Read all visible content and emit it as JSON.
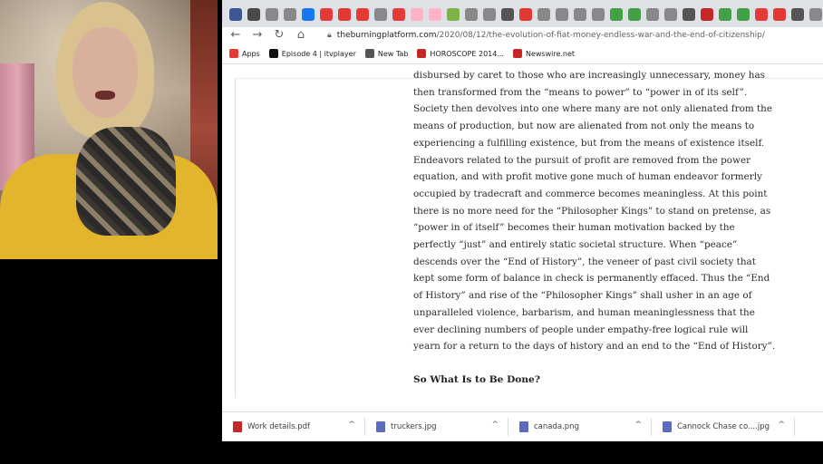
{
  "browser": {
    "tab_icon_colors": [
      "#3b5998",
      "#4a4a4a",
      "#888",
      "#888",
      "#1877f2",
      "#e53935",
      "#e53935",
      "#e53935",
      "#888",
      "#e53935",
      "#ffb3c7",
      "#ffb3c7",
      "#7cb342",
      "#888",
      "#888",
      "#555",
      "#e53935",
      "#888",
      "#888",
      "#888",
      "#888",
      "#43a047",
      "#43a047",
      "#888",
      "#888",
      "#555",
      "#c62828",
      "#43a047",
      "#43a047",
      "#e53935",
      "#e53935",
      "#555",
      "#888",
      "#888",
      "#1565c0"
    ],
    "url_domain": "theburningplatform.com",
    "url_path": "/2020/08/12/the-evolution-of-fiat-money-endless-war-and-the-end-of-citizenship/",
    "bookmarks": [
      {
        "label": "Apps",
        "icon": "apps-grid-icon",
        "color": "#e53935"
      },
      {
        "label": "Episode 4 | itvplayer",
        "icon": "itv-icon",
        "color": "#111"
      },
      {
        "label": "New Tab",
        "icon": "globe-icon",
        "color": "#555"
      },
      {
        "label": "HOROSCOPE 2014...",
        "icon": "n-icon",
        "color": "#c62828"
      },
      {
        "label": "Newswire.net",
        "icon": "n-icon",
        "color": "#c62828"
      }
    ]
  },
  "article": {
    "lines": [
      "disbursed by caret to those who are increasingly unnecessary, money has",
      "then transformed from the “means to power” to “power in of its self”.",
      "Society then devolves into one where many are not only alienated from the",
      "means of production, but now are alienated from not only the means to",
      "experiencing a fulfilling existence, but from the means of existence itself.",
      "Endeavors related to the pursuit of profit are removed from the power",
      "equation, and with profit motive gone much of human endeavor formerly",
      "occupied by tradecraft and commerce becomes meaningless.  At this point",
      "there is no more need for the “Philosopher Kings” to stand on pretense, as",
      "“power in of itself” becomes their human motivation backed by the",
      "perfectly “just” and entirely static societal structure.  When “peace”",
      "descends over the “End of History”, the veneer of past civil society that",
      "kept some form of balance in check is permanently effaced.  Thus the “End",
      "of History” and rise of the “Philosopher Kings” shall usher in an age of",
      "unparalleled violence, barbarism, and human meaninglessness that the",
      "ever declining numbers of people under empathy-free logical rule will",
      "yearn for a return to the days of history and an end to the “End of History”."
    ],
    "heading": "So What Is to Be Done?"
  },
  "downloads": [
    {
      "name": "Work details.pdf",
      "color": "#c62828",
      "chevron": "^"
    },
    {
      "name": "truckers.jpg",
      "color": "#5c6bc0",
      "chevron": "^"
    },
    {
      "name": "canada.png",
      "color": "#5c6bc0",
      "chevron": "^"
    },
    {
      "name": "Cannock Chase co....jpg",
      "color": "#5c6bc0",
      "chevron": "^"
    }
  ]
}
